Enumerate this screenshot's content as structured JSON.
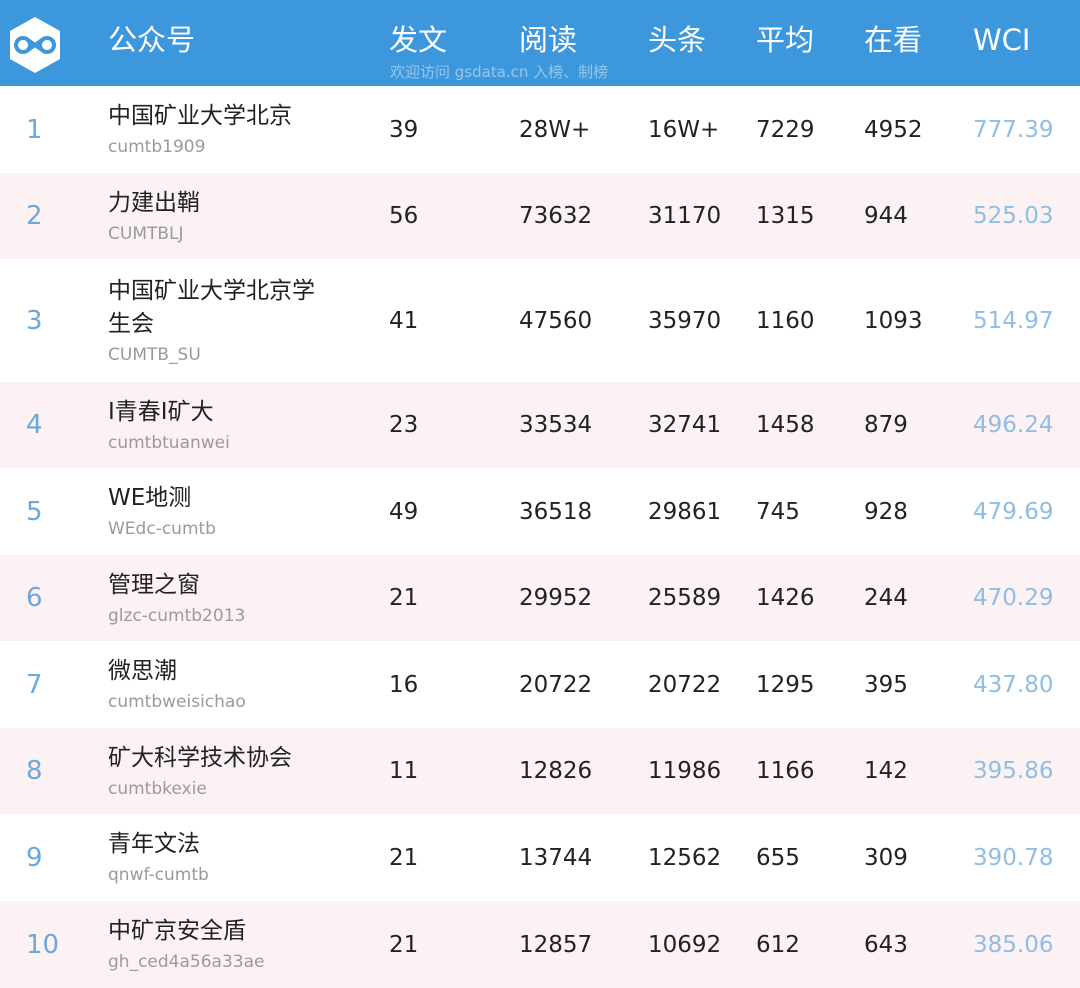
{
  "header": {
    "columns": {
      "account": "公众号",
      "posts": "发文",
      "reads": "阅读",
      "headline": "头条",
      "average": "平均",
      "looking": "在看",
      "wci": "WCI"
    },
    "watermark": "欢迎访问 gsdata.cn 入榜、制榜"
  },
  "rows": [
    {
      "rank": "1",
      "name": "中国矿业大学北京",
      "id": "cumtb1909",
      "posts": "39",
      "reads": "28W+",
      "headline": "16W+",
      "average": "7229",
      "looking": "4952",
      "wci": "777.39"
    },
    {
      "rank": "2",
      "name": "力建出鞘",
      "id": "CUMTBLJ",
      "posts": "56",
      "reads": "73632",
      "headline": "31170",
      "average": "1315",
      "looking": "944",
      "wci": "525.03"
    },
    {
      "rank": "3",
      "name": "中国矿业大学北京学生会",
      "id": "CUMTB_SU",
      "posts": "41",
      "reads": "47560",
      "headline": "35970",
      "average": "1160",
      "looking": "1093",
      "wci": "514.97"
    },
    {
      "rank": "4",
      "name": "I青春I矿大",
      "id": "cumtbtuanwei",
      "posts": "23",
      "reads": "33534",
      "headline": "32741",
      "average": "1458",
      "looking": "879",
      "wci": "496.24"
    },
    {
      "rank": "5",
      "name": "WE地测",
      "id": "WEdc-cumtb",
      "posts": "49",
      "reads": "36518",
      "headline": "29861",
      "average": "745",
      "looking": "928",
      "wci": "479.69"
    },
    {
      "rank": "6",
      "name": "管理之窗",
      "id": "glzc-cumtb2013",
      "posts": "21",
      "reads": "29952",
      "headline": "25589",
      "average": "1426",
      "looking": "244",
      "wci": "470.29"
    },
    {
      "rank": "7",
      "name": "微思潮",
      "id": "cumtbweisichao",
      "posts": "16",
      "reads": "20722",
      "headline": "20722",
      "average": "1295",
      "looking": "395",
      "wci": "437.80"
    },
    {
      "rank": "8",
      "name": "矿大科学技术协会",
      "id": "cumtbkexie",
      "posts": "11",
      "reads": "12826",
      "headline": "11986",
      "average": "1166",
      "looking": "142",
      "wci": "395.86"
    },
    {
      "rank": "9",
      "name": "青年文法",
      "id": "qnwf-cumtb",
      "posts": "21",
      "reads": "13744",
      "headline": "12562",
      "average": "655",
      "looking": "309",
      "wci": "390.78"
    },
    {
      "rank": "10",
      "name": "中矿京安全盾",
      "id": "gh_ced4a56a33ae",
      "posts": "21",
      "reads": "12857",
      "headline": "10692",
      "average": "612",
      "looking": "643",
      "wci": "385.06"
    }
  ],
  "colors": {
    "header_bg": "#3d97dc",
    "row_alt_bg": "#fdf2f3",
    "rank": "#6aa9da",
    "wci": "#8fbde4"
  },
  "icons": {
    "logo": "gsdata-infinity-logo-icon"
  }
}
